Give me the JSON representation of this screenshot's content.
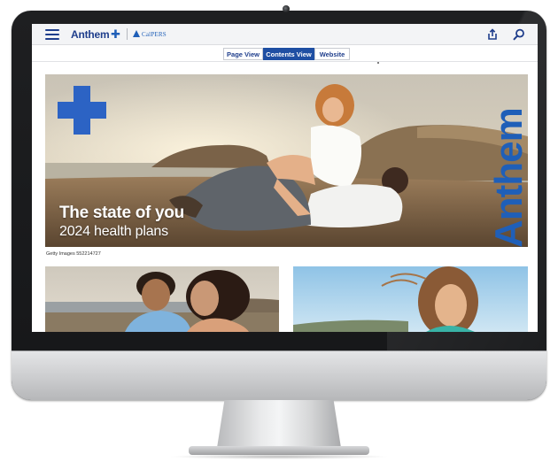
{
  "header": {
    "brand": "Anthem",
    "brand_icon": "blue-cross-shield-icon",
    "partner": "CalPERS",
    "menu_icon": "hamburger-menu-icon",
    "share_icon": "share-icon",
    "search_icon": "search-icon"
  },
  "tabs": [
    {
      "label": "Page View",
      "active": false
    },
    {
      "label": "Contents View",
      "active": true
    },
    {
      "label": "Website",
      "active": false
    }
  ],
  "hero": {
    "title": "The state of you",
    "subtitle": "2024 health plans",
    "vertical_brand": "Anthem",
    "logo_icon": "blue-cross-logo-icon",
    "credit": "Getty Images 552214727"
  },
  "colors": {
    "brand_blue": "#1f5fb8",
    "nav_blue": "#1f3e8c",
    "active_tab": "#1f4fa3"
  }
}
